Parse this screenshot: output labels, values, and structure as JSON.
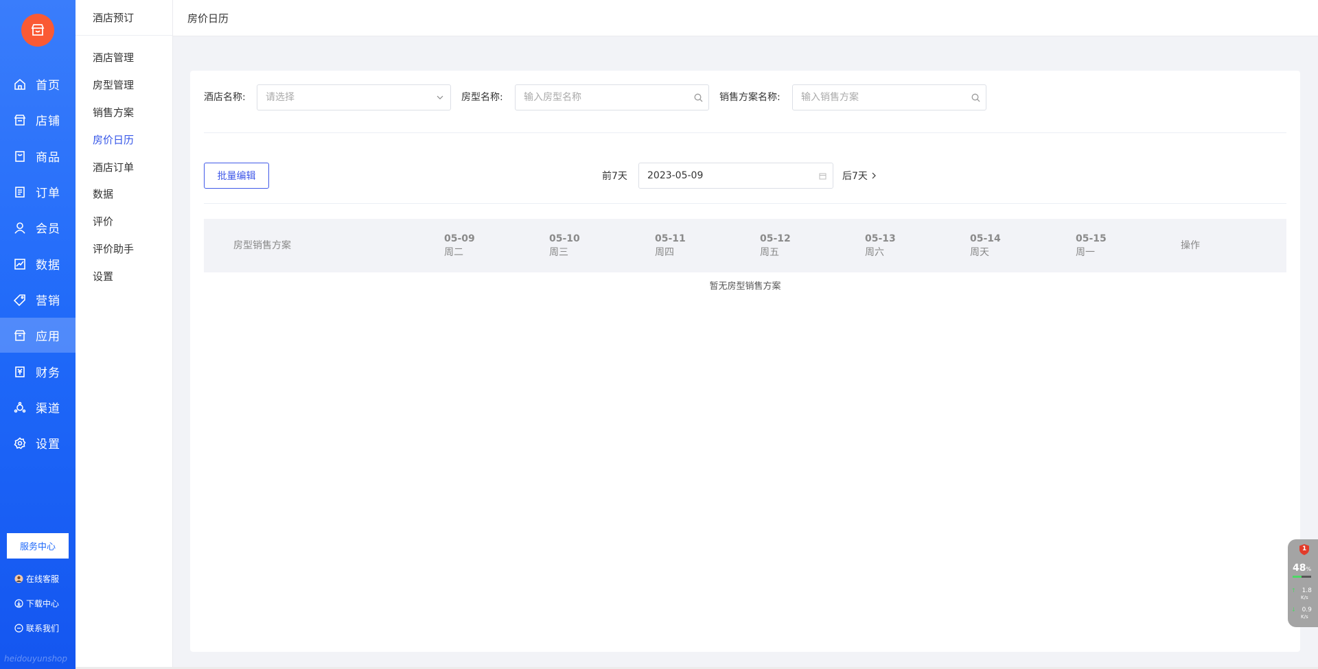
{
  "colors": {
    "nav_gradient_top": "#3a7dfb",
    "nav_gradient_bottom": "#1456f0",
    "accent": "#3556e8",
    "logo": "#fa5a34"
  },
  "nav": {
    "items": [
      {
        "label": "首页",
        "icon": "home-icon"
      },
      {
        "label": "店铺",
        "icon": "store-icon"
      },
      {
        "label": "商品",
        "icon": "goods-icon"
      },
      {
        "label": "订单",
        "icon": "order-icon"
      },
      {
        "label": "会员",
        "icon": "member-icon"
      },
      {
        "label": "数据",
        "icon": "chart-icon"
      },
      {
        "label": "营销",
        "icon": "tag-icon"
      },
      {
        "label": "应用",
        "icon": "app-box-icon",
        "active": true
      },
      {
        "label": "财务",
        "icon": "finance-icon"
      },
      {
        "label": "渠道",
        "icon": "channel-icon"
      },
      {
        "label": "设置",
        "icon": "gear-icon"
      }
    ],
    "service_center": "服务中心",
    "bottom_links": [
      {
        "label": "在线客服",
        "icon": "avatar-icon"
      },
      {
        "label": "下载中心",
        "icon": "download-icon"
      },
      {
        "label": "联系我们",
        "icon": "chat-icon"
      }
    ],
    "watermark": "heidouyunshop"
  },
  "subnav": {
    "title": "酒店预订",
    "items": [
      {
        "label": "酒店管理"
      },
      {
        "label": "房型管理"
      },
      {
        "label": "销售方案"
      },
      {
        "label": "房价日历",
        "active": true
      },
      {
        "label": "酒店订单"
      },
      {
        "label": "数据"
      },
      {
        "label": "评价"
      },
      {
        "label": "评价助手"
      },
      {
        "label": "设置"
      }
    ]
  },
  "header": {
    "title": "房价日历"
  },
  "filters": {
    "hotel_label": "酒店名称:",
    "hotel_placeholder": "请选择",
    "room_label": "房型名称:",
    "room_placeholder": "输入房型名称",
    "plan_label": "销售方案名称:",
    "plan_placeholder": "输入销售方案"
  },
  "toolbar": {
    "batch_edit": "批量编辑",
    "prev": "前7天",
    "date": "2023-05-09",
    "next": "后7天"
  },
  "table": {
    "first_col": "房型销售方案",
    "days": [
      {
        "date": "05-09",
        "weekday": "周二"
      },
      {
        "date": "05-10",
        "weekday": "周三"
      },
      {
        "date": "05-11",
        "weekday": "周四"
      },
      {
        "date": "05-12",
        "weekday": "周五"
      },
      {
        "date": "05-13",
        "weekday": "周六"
      },
      {
        "date": "05-14",
        "weekday": "周天"
      },
      {
        "date": "05-15",
        "weekday": "周一"
      }
    ],
    "action_col": "操作",
    "empty_text": "暂无房型销售方案"
  },
  "net_widget": {
    "badge": "1",
    "cpu_percent": "48",
    "cpu_unit": "%",
    "cpu_fraction": 0.48,
    "upload": "1.8",
    "upload_unit": "K/s",
    "download": "0.9",
    "download_unit": "K/s"
  }
}
